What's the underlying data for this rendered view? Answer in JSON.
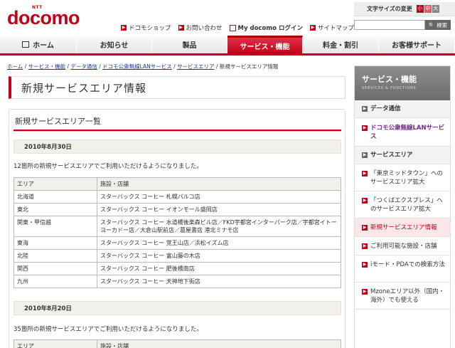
{
  "header": {
    "logo_ntt": "NTT",
    "logo_text": "docomo",
    "text_size_label": "文字サイズの変更",
    "text_sizes": [
      "小",
      "中",
      "大"
    ],
    "search_placeholder": "",
    "search_button": "検索",
    "topnav": [
      "ドコモショップ",
      "お問い合わせ",
      "My docomo ログイン",
      "サイトマップ"
    ]
  },
  "mainnav": [
    "ホーム",
    "お知らせ",
    "製品",
    "サービス・機能",
    "料金・割引",
    "お客様サポート"
  ],
  "breadcrumb": [
    "ホーム",
    "サービス・機能",
    "データ通信",
    "ドコモ公衆無線LANサービス",
    "サービスエリア",
    "新規サービスエリア情報"
  ],
  "page_title": "新規サービスエリア情報",
  "content": {
    "section_title": "新規サービスエリア一覧",
    "blocks": [
      {
        "date": "2010年8月30日",
        "intro": "12箇所の新規サービスエリアでご利用いただけるようになりました。",
        "col_area": "エリア",
        "col_facility": "施設・店舗",
        "rows": [
          {
            "area": "北海道",
            "facility": "スターバックス コーヒー 札幌パルコ店"
          },
          {
            "area": "東北",
            "facility": "スターバックス コーヒー イオンモール盛岡店"
          },
          {
            "area": "関東・甲信越",
            "facility": "スターバックス コーヒー 水道橋後楽森ビル店／FKD宇都宮インターパーク店／宇都宮イトーヨーカドー店／大倉山駅前店／葛屋書店 港北ミナモ店"
          },
          {
            "area": "東海",
            "facility": "スターバックス コーヒー 覚王山店／浜松イズム店"
          },
          {
            "area": "北陸",
            "facility": "スターバックス コーヒー 富山藤の木店"
          },
          {
            "area": "関西",
            "facility": "スターバックス コーヒー 肥後橋南店"
          },
          {
            "area": "九州",
            "facility": "スターバックス コーヒー 天神地下街店"
          }
        ]
      },
      {
        "date": "2010年8月20日",
        "intro": "35箇所の新規サービスエリアでご利用いただけるようになりました。",
        "col_area": "エリア",
        "col_facility": "施設・店舗"
      }
    ]
  },
  "sidebar": {
    "title": "サービス・機能",
    "subtitle": "SERVICES & FUNCTIONS",
    "items": [
      {
        "label": "データ通信",
        "kind": "category"
      },
      {
        "label": "ドコモ公衆無線LANサービス",
        "kind": "link"
      },
      {
        "label": "サービスエリア",
        "kind": "category"
      },
      {
        "label": "「東京ミッドタウン」へのサービスエリア拡大",
        "kind": "sub"
      },
      {
        "label": "「つくばエクスプレス」へのサービスエリア拡大",
        "kind": "sub"
      },
      {
        "label": "新規サービスエリア情報",
        "kind": "current"
      },
      {
        "label": "ご利用可能な施設・店舗",
        "kind": "sub"
      },
      {
        "label": "iモード・PDAでの検索方法",
        "kind": "sub"
      },
      {
        "label": "Mzoneエリア以外（国内・海外）でも使える",
        "kind": "sub"
      }
    ]
  },
  "colors": {
    "brand_red": "#c4001a",
    "size_small": "#c4001a",
    "size_medium": "#e05a6a",
    "size_large": "#888888"
  }
}
